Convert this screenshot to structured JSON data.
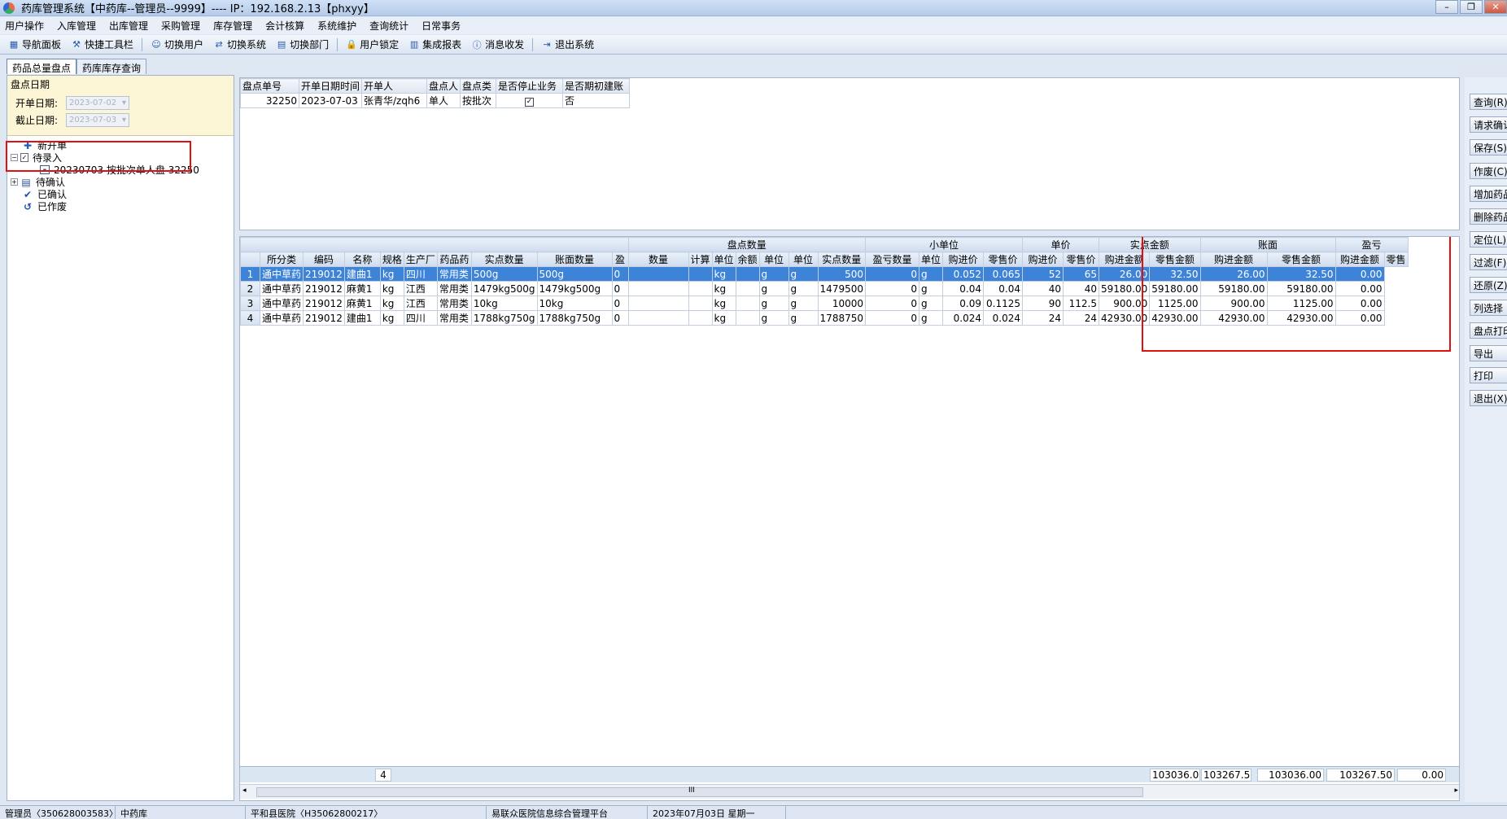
{
  "window": {
    "title": "药库管理系统【中药库--管理员--9999】---- IP：192.168.2.13【phxyy】"
  },
  "menu": [
    "用户操作",
    "入库管理",
    "出库管理",
    "采购管理",
    "库存管理",
    "会计核算",
    "系统维护",
    "查询统计",
    "日常事务"
  ],
  "toolbar": [
    {
      "label": "导航面板",
      "icon": "panel-icon"
    },
    {
      "label": "快捷工具栏",
      "icon": "tools-icon"
    },
    {
      "label": "切换用户",
      "icon": "switch-user-icon"
    },
    {
      "label": "切换系统",
      "icon": "switch-system-icon"
    },
    {
      "label": "切换部门",
      "icon": "switch-dept-icon"
    },
    {
      "label": "用户锁定",
      "icon": "lock-icon"
    },
    {
      "label": "集成报表",
      "icon": "report-icon"
    },
    {
      "label": "消息收发",
      "icon": "info-icon"
    },
    {
      "label": "退出系统",
      "icon": "exit-icon"
    }
  ],
  "tabs": [
    "药品总量盘点",
    "药库库存查询"
  ],
  "left": {
    "date_title": "盘点日期",
    "start_label": "开单日期:",
    "start_value": "2023-07-02",
    "end_label": "截止日期:",
    "end_value": "2023-07-03",
    "tree": {
      "new": "新开单",
      "pending": "待录入",
      "pending_child": "20230703 按批次单人盘 32250",
      "to_confirm": "待确认",
      "confirmed": "已确认",
      "voided": "已作废"
    }
  },
  "header_grid": {
    "columns": [
      "盘点单号",
      "开单日期时间",
      "开单人",
      "盘点人",
      "盘点类",
      "是否停止业务",
      "是否期初建账"
    ],
    "row": {
      "id": "32250",
      "date": "2023-07-03",
      "person": "张青华/zqh6",
      "by": "单人",
      "type": "按批次",
      "stop": true,
      "init": "否"
    }
  },
  "detail_grid": {
    "groups": [
      "盘点数量",
      "小单位",
      "单价",
      "实点金额",
      "账面",
      "盈亏"
    ],
    "columns": [
      "所分类",
      "编码",
      "名称",
      "规格",
      "生产厂",
      "药品药",
      "实点数量",
      "账面数量",
      "盈",
      "数量",
      "计算",
      "单位",
      "余额",
      "单位",
      "单位",
      "实点数量",
      "盈亏数量",
      "单位",
      "购进价",
      "零售价",
      "购进价",
      "零售价",
      "购进金额",
      "零售金额",
      "购进金额",
      "零售金额",
      "购进金额",
      "零售"
    ],
    "rows": [
      [
        "1",
        "通中草药",
        "219012",
        "建曲1",
        "kg",
        "四川",
        "常用类",
        "500g",
        "500g",
        "0",
        "",
        "",
        "kg",
        "",
        "g",
        "g",
        "500",
        "0",
        "g",
        "0.052",
        "0.065",
        "52",
        "65",
        "26.00",
        "32.50",
        "26.00",
        "32.50",
        "0.00"
      ],
      [
        "2",
        "通中草药",
        "219012",
        "麻黄1",
        "kg",
        "江西",
        "常用类",
        "1479kg500g",
        "1479kg500g",
        "0",
        "",
        "",
        "kg",
        "",
        "g",
        "g",
        "1479500",
        "0",
        "g",
        "0.04",
        "0.04",
        "40",
        "40",
        "59180.00",
        "59180.00",
        "59180.00",
        "59180.00",
        "0.00"
      ],
      [
        "3",
        "通中草药",
        "219012",
        "麻黄1",
        "kg",
        "江西",
        "常用类",
        "10kg",
        "10kg",
        "0",
        "",
        "",
        "kg",
        "",
        "g",
        "g",
        "10000",
        "0",
        "g",
        "0.09",
        "0.1125",
        "90",
        "112.5",
        "900.00",
        "1125.00",
        "900.00",
        "1125.00",
        "0.00"
      ],
      [
        "4",
        "通中草药",
        "219012",
        "建曲1",
        "kg",
        "四川",
        "常用类",
        "1788kg750g",
        "1788kg750g",
        "0",
        "",
        "",
        "kg",
        "",
        "g",
        "g",
        "1788750",
        "0",
        "g",
        "0.024",
        "0.024",
        "24",
        "24",
        "42930.00",
        "42930.00",
        "42930.00",
        "42930.00",
        "0.00"
      ]
    ],
    "footer": {
      "count": "4",
      "t1": "103036.0",
      "t2": "103267.5",
      "t3": "103036.00",
      "t4": "103267.50",
      "t5": "0.00"
    },
    "scroll_marker": "III"
  },
  "right_buttons": [
    "查询(R)",
    "请求确认",
    "保存(S)",
    "作废(C)",
    "增加药品",
    "删除药品",
    "定位(L)",
    "过滤(F)",
    "还原(Z)",
    "列选择",
    "盘点打印",
    "导出",
    "打印",
    "退出(X)"
  ],
  "status": [
    "管理员〈350628003583〉",
    "中药库",
    "平和县医院〈H35062800217〉",
    "易联众医院信息综合管理平台",
    "2023年07月03日 星期一"
  ],
  "colors": {
    "selected_row": "#3d83d8",
    "highlight_box": "#e01010"
  }
}
